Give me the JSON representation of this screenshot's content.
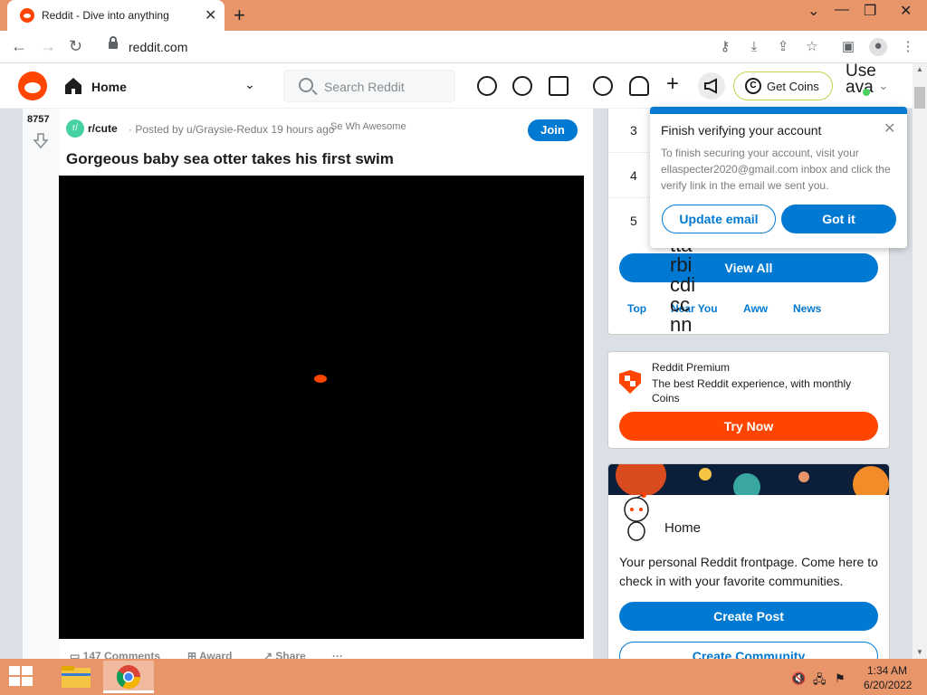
{
  "browser": {
    "tab_title": "Reddit - Dive into anything",
    "tab_close": "✕",
    "new_tab": "+",
    "url": "reddit.com",
    "win_controls": [
      "⌄",
      "—",
      "❐",
      "✕"
    ]
  },
  "header": {
    "home_label": "Home",
    "search_placeholder": "Search Reddit",
    "get_coins_label": "Get Coins",
    "user_label": "Use\nava"
  },
  "post": {
    "votes": "8757",
    "subreddit_icon_text": "r/",
    "subreddit": "r/cute",
    "posted_by": "· Posted by u/Graysie-Redux 19 hours ago",
    "badges_broken": "Se Wh Awesome",
    "join_label": "Join",
    "title": "Gorgeous baby sea otter takes his first swim",
    "comments_label": "147 Comments",
    "award_label": "Award",
    "share_label": "Share",
    "more_label": "···"
  },
  "sidebar": {
    "ranks": [
      "3",
      "4",
      "5"
    ],
    "view_all_label": "View All",
    "chips": [
      "Top",
      "Near You",
      "Aww",
      "News"
    ],
    "premium_title": "Reddit Premium",
    "premium_desc": "The best Reddit experience, with monthly Coins",
    "try_now_label": "Try Now",
    "home_card_title": "Home",
    "home_card_desc": "Your personal Reddit frontpage. Come here to check in with your favorite communities.",
    "create_post_label": "Create Post",
    "create_community_label": "Create Community"
  },
  "glitch_text": "ttarbicdiccnn",
  "popup": {
    "title": "Finish verifying your account",
    "description": "To finish securing your account, visit your ellaspecter2020@gmail.com inbox and click the verify link in the email we sent you.",
    "update_email_label": "Update email",
    "got_it_label": "Got it",
    "close": "✕"
  },
  "taskbar": {
    "time": "1:34 AM",
    "date": "6/20/2022"
  },
  "colors": {
    "reddit_orange": "#ff4500",
    "reddit_blue": "#0079d3",
    "browser_frame": "#e8956a"
  }
}
